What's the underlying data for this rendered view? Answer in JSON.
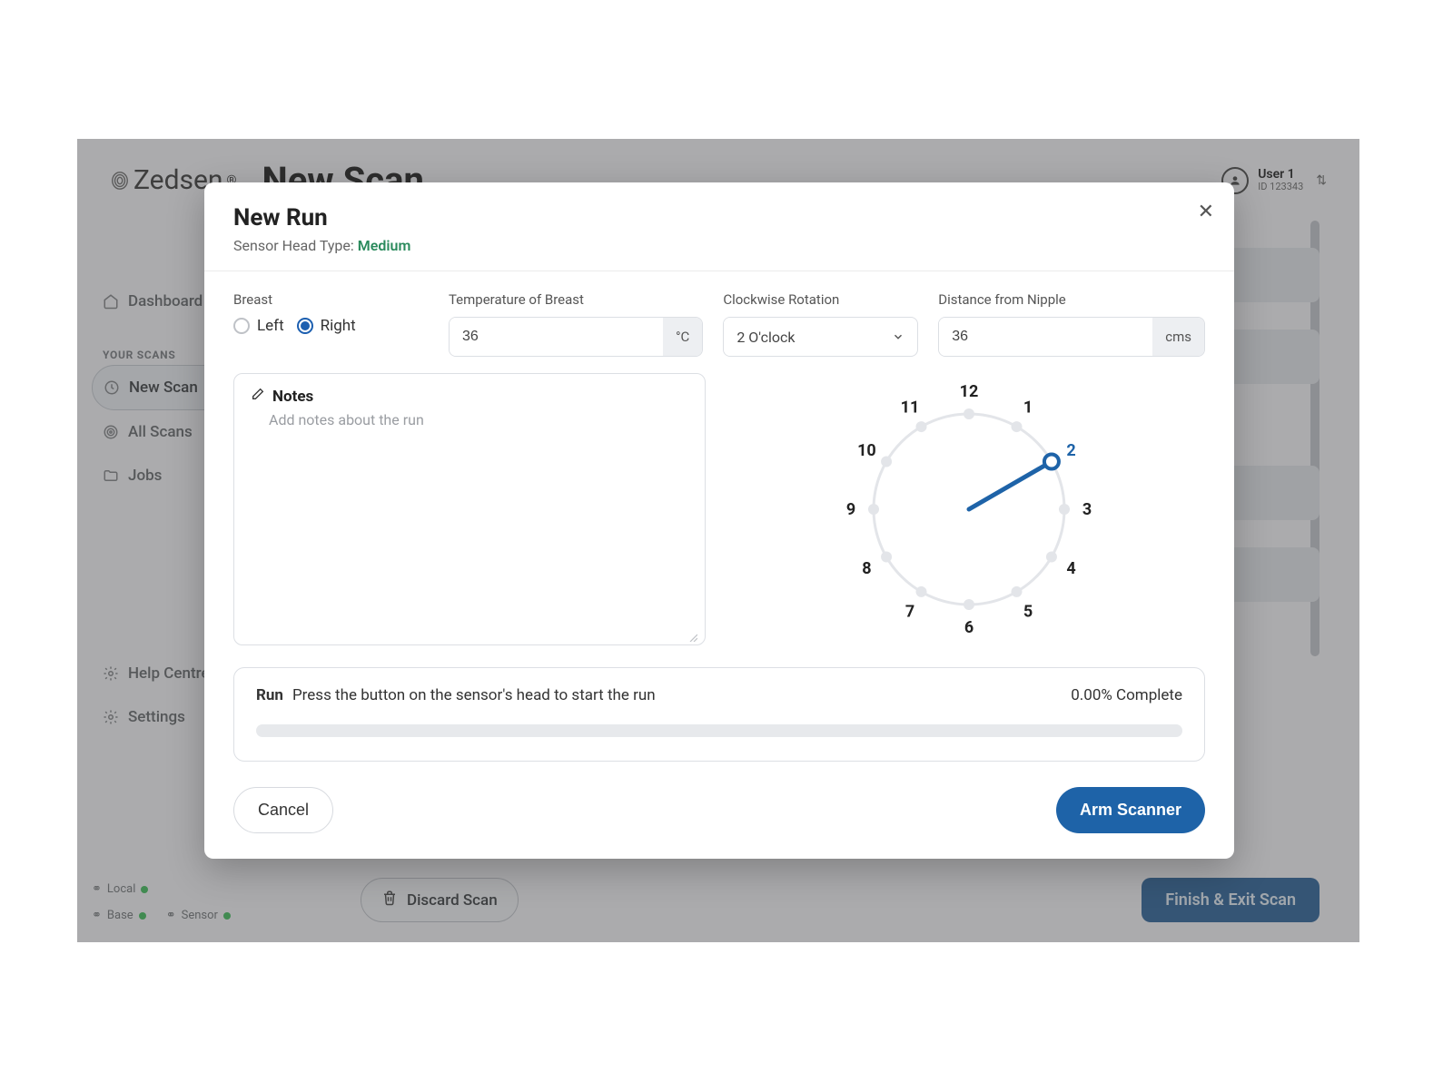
{
  "brand": {
    "name": "Zedsen"
  },
  "page": {
    "title": "New Scan"
  },
  "user": {
    "name": "User 1",
    "id_label": "ID 123343"
  },
  "sidebar": {
    "dashboard": "Dashboard",
    "section_label": "YOUR SCANS",
    "new_scan": "New Scan",
    "all_scans": "All Scans",
    "jobs": "Jobs",
    "help": "Help Centre",
    "settings": "Settings"
  },
  "status": {
    "local": "Local",
    "base": "Base",
    "sensor": "Sensor"
  },
  "bottom": {
    "discard": "Discard Scan",
    "finish": "Finish & Exit Scan"
  },
  "modal": {
    "title": "New Run",
    "sensor_label": "Sensor Head Type:",
    "sensor_value": "Medium",
    "fields": {
      "breast": {
        "label": "Breast",
        "left": "Left",
        "right": "Right",
        "selected": "right"
      },
      "temperature": {
        "label": "Temperature of Breast",
        "value": "36",
        "unit": "°C"
      },
      "rotation": {
        "label": "Clockwise Rotation",
        "value": "2 O'clock"
      },
      "distance": {
        "label": "Distance from Nipple",
        "value": "36",
        "unit": "cms"
      }
    },
    "notes": {
      "title": "Notes",
      "placeholder": "Add notes about the run"
    },
    "clock_hours": [
      "12",
      "1",
      "2",
      "3",
      "4",
      "5",
      "6",
      "7",
      "8",
      "9",
      "10",
      "11"
    ],
    "clock_selected_hour": 2,
    "run": {
      "lead_bold": "Run",
      "lead_text": "Press the button on the sensor's head to start the run",
      "progress_label": "0.00% Complete"
    },
    "footer": {
      "cancel": "Cancel",
      "arm": "Arm Scanner"
    }
  }
}
